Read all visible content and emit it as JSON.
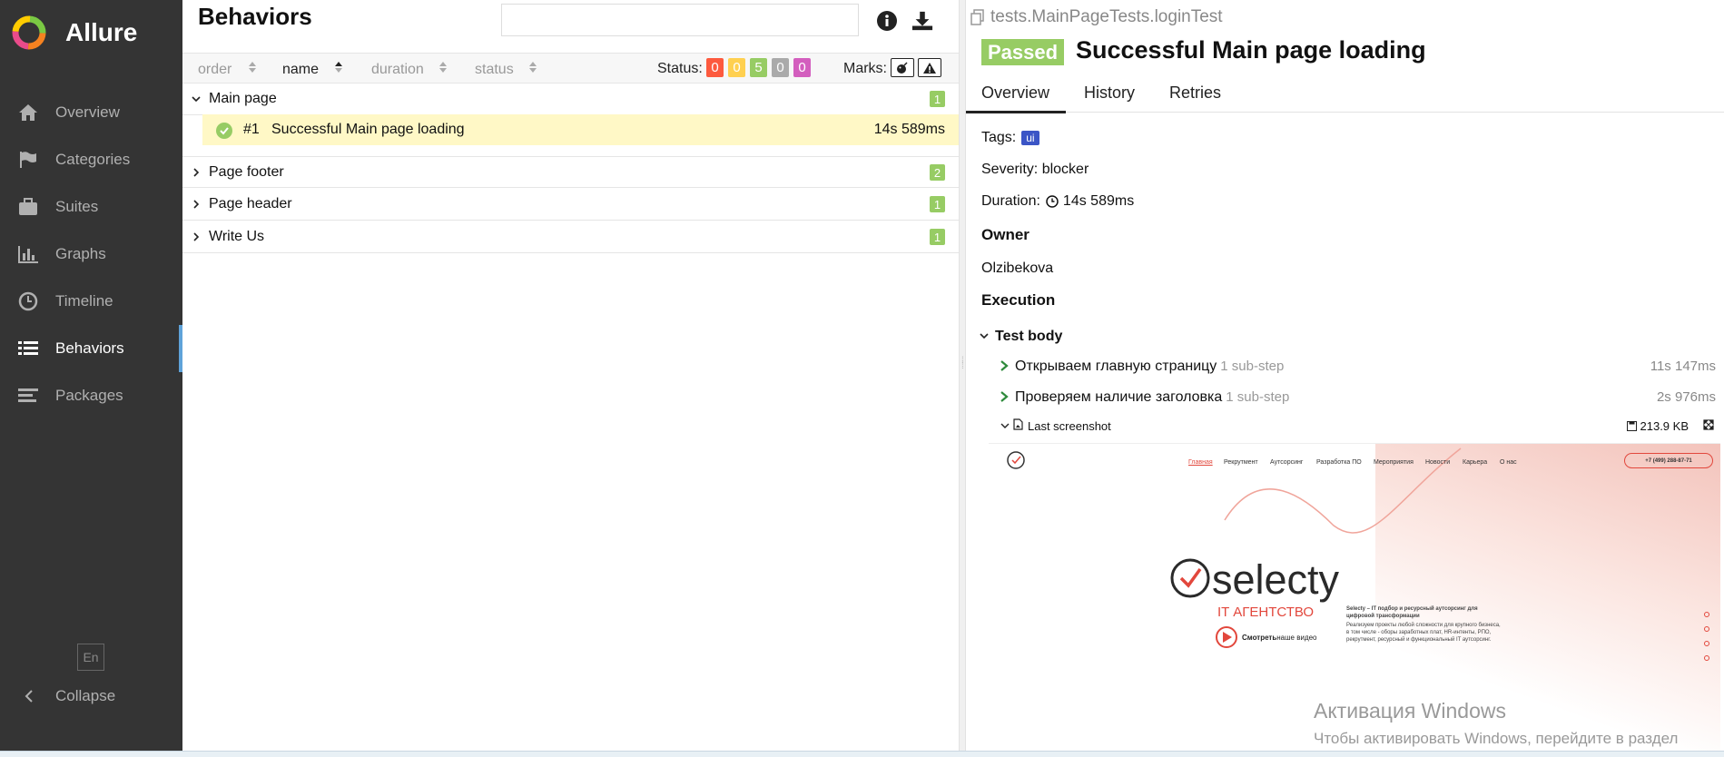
{
  "app": {
    "name": "Allure",
    "lang": "En",
    "collapse_label": "Collapse"
  },
  "sidebar": {
    "items": [
      {
        "label": "Overview",
        "icon": "home-icon"
      },
      {
        "label": "Categories",
        "icon": "flag-icon"
      },
      {
        "label": "Suites",
        "icon": "briefcase-icon"
      },
      {
        "label": "Graphs",
        "icon": "bar-chart-icon"
      },
      {
        "label": "Timeline",
        "icon": "clock-icon"
      },
      {
        "label": "Behaviors",
        "icon": "list-icon",
        "active": true
      },
      {
        "label": "Packages",
        "icon": "align-left-icon"
      }
    ]
  },
  "behaviors": {
    "title": "Behaviors",
    "search_placeholder": "",
    "sort": {
      "order": "order",
      "name": "name",
      "duration": "duration",
      "status": "status"
    },
    "status_label": "Status:",
    "status_counts": [
      {
        "value": "0",
        "color": "#fd5a3e"
      },
      {
        "value": "0",
        "color": "#ffd050"
      },
      {
        "value": "5",
        "color": "#97cc64"
      },
      {
        "value": "0",
        "color": "#aaaaaa"
      },
      {
        "value": "0",
        "color": "#d35ebe"
      }
    ],
    "marks_label": "Marks:",
    "groups": [
      {
        "name": "Main page",
        "count": "1",
        "expanded": true
      },
      {
        "name": "Page footer",
        "count": "2"
      },
      {
        "name": "Page header",
        "count": "1"
      },
      {
        "name": "Write Us",
        "count": "1"
      }
    ],
    "test": {
      "num": "#1",
      "name": "Successful Main page loading",
      "duration": "14s 589ms"
    }
  },
  "detail": {
    "path": "tests.MainPageTests.loginTest",
    "status": "Passed",
    "title": "Successful Main page loading",
    "tabs": [
      "Overview",
      "History",
      "Retries"
    ],
    "tags_label": "Tags:",
    "tag": "ui",
    "severity": "Severity: blocker",
    "duration_label": "Duration:",
    "duration": "14s 589ms",
    "owner_heading": "Owner",
    "owner": "Olzibekova",
    "execution_heading": "Execution",
    "test_body": "Test body",
    "steps": [
      {
        "name": "Открываем главную страницу",
        "sub": "1 sub-step",
        "duration": "11s 147ms"
      },
      {
        "name": "Проверяем наличие заголовка",
        "sub": "1 sub-step",
        "duration": "2s 976ms"
      }
    ],
    "attachment": {
      "name": "Last screenshot",
      "size": "213.9 KB"
    }
  },
  "screenshot": {
    "nav": [
      "Главная",
      "Рекрутмент",
      "Аутсорсинг",
      "Разработка ПО",
      "Мероприятия",
      "Новости",
      "Карьера",
      "О нас"
    ],
    "phone": "+7 (499) 288-87-71",
    "logo": "selecty",
    "agency": "IT АГЕНТСТВО",
    "video_bold": "Смотреть",
    "video_rest": " наше видео",
    "desc_bold": "Selecty – IT подбор и ресурсный аутсорсинг для цифровой трансформации",
    "desc": "Реализуем проекты любой сложности для крупного бизнеса, в том числе - оборы заработных плат, HR-интенты, РПО, рекрутмент, ресурсный и функциональный IT аутсорсинг."
  },
  "watermark": {
    "title": "Активация Windows",
    "subtitle": "Чтобы активировать Windows, перейдите в раздел"
  }
}
